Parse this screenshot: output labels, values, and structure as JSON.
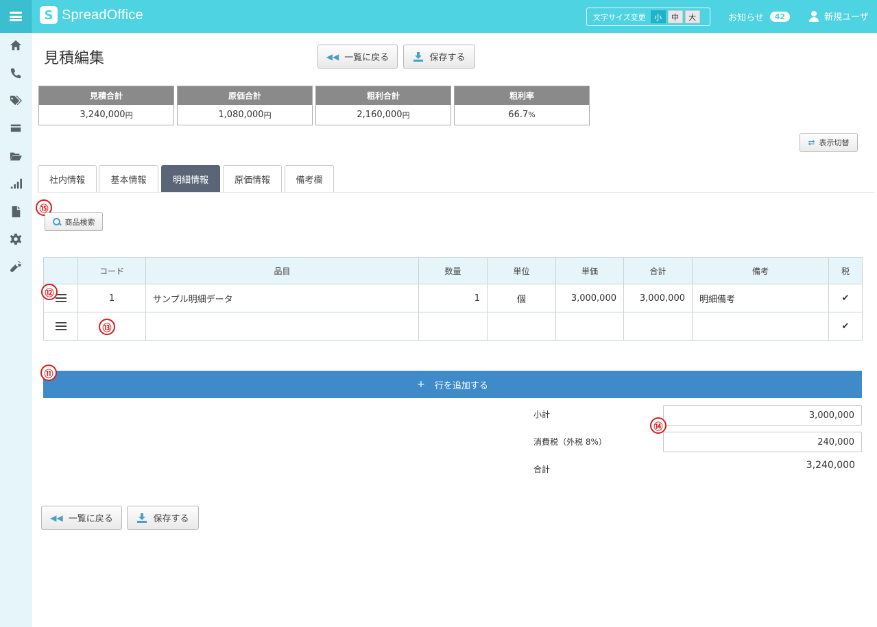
{
  "header": {
    "logo_text": "SpreadOffice",
    "font_size_label": "文字サイズ変更",
    "font_sizes": [
      "小",
      "中",
      "大"
    ],
    "font_size_selected": "小",
    "notice_label": "お知らせ",
    "notice_count": "42",
    "user_name": "新規ユーザ"
  },
  "sidebar": {
    "items": [
      {
        "icon": "home-icon"
      },
      {
        "icon": "phone-icon"
      },
      {
        "icon": "tags-icon"
      },
      {
        "icon": "credit-card-icon"
      },
      {
        "icon": "folder-open-icon"
      },
      {
        "icon": "bar-chart-icon"
      },
      {
        "icon": "document-icon"
      },
      {
        "icon": "gear-icon"
      },
      {
        "icon": "wrench-icon"
      }
    ]
  },
  "page": {
    "title": "見積編集",
    "back_label": "一覧に戻る",
    "save_label": "保存する",
    "toggle_label": "表示切替"
  },
  "summary": [
    {
      "label": "見積合計",
      "value": "3,240,000",
      "unit": "円"
    },
    {
      "label": "原価合計",
      "value": "1,080,000",
      "unit": "円"
    },
    {
      "label": "粗利合計",
      "value": "2,160,000",
      "unit": "円"
    },
    {
      "label": "粗利率",
      "value": "66.7",
      "unit": "%"
    }
  ],
  "tabs": [
    {
      "label": "社内情報",
      "active": false
    },
    {
      "label": "基本情報",
      "active": false
    },
    {
      "label": "明細情報",
      "active": true
    },
    {
      "label": "原価情報",
      "active": false
    },
    {
      "label": "備考欄",
      "active": false
    }
  ],
  "markers": {
    "m15": "⑮",
    "m12": "⑫",
    "m13": "⑬",
    "m11": "⑪",
    "m14": "⑭"
  },
  "search_label": "商品検索",
  "table": {
    "headers": [
      "",
      "コード",
      "品目",
      "数量",
      "単位",
      "単価",
      "合計",
      "備考",
      "税"
    ],
    "rows": [
      {
        "code": "1",
        "item": "サンプル明細データ",
        "qty": "1",
        "unit": "個",
        "price": "3,000,000",
        "total": "3,000,000",
        "note": "明細備考",
        "tax": "✔"
      },
      {
        "code": "",
        "item": "",
        "qty": "",
        "unit": "",
        "price": "",
        "total": "",
        "note": "",
        "tax": "✔"
      }
    ]
  },
  "add_row_label": "行を追加する",
  "totals": {
    "subtotal_label": "小計",
    "subtotal_value": "3,000,000",
    "tax_label": "消費税（外税 8%）",
    "tax_value": "240,000",
    "total_label": "合計",
    "total_value": "3,240,000"
  }
}
